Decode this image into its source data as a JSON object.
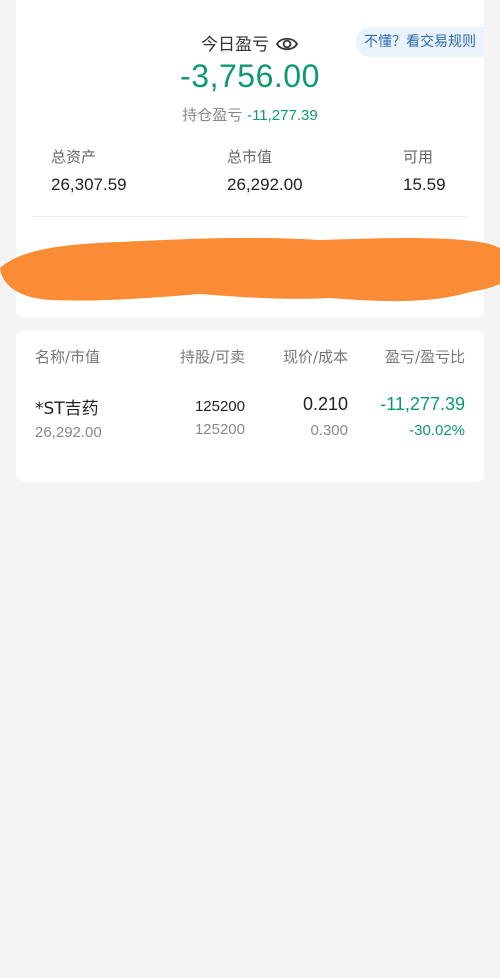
{
  "account": {
    "today_pl_label": "今日盈亏",
    "rules_button": "不懂？看交易规则",
    "today_pl_value": "-3,756.00",
    "holding_pl_label": "持仓盈亏",
    "holding_pl_value": "-11,277.39",
    "stats": [
      {
        "label": "总资产",
        "value": "26,307.59"
      },
      {
        "label": "总市值",
        "value": "26,292.00"
      },
      {
        "label": "可用",
        "value": "15.59"
      }
    ],
    "redaction_color": "#fa8c35"
  },
  "positions": {
    "headers": [
      "名称/市值",
      "持股/可卖",
      "现价/成本",
      "盈亏/盈亏比"
    ],
    "rows": [
      {
        "name": "*ST吉药",
        "market_value": "26,292.00",
        "holding": "125200",
        "available": "125200",
        "price": "0.210",
        "cost": "0.300",
        "pl": "-11,277.39",
        "pl_ratio": "-30.02%"
      }
    ]
  },
  "colors": {
    "loss_green": "#0e9a6b",
    "link_blue": "#2b6cb0",
    "background": "#f4f4f4"
  },
  "icons": {
    "visibility": "eye-icon"
  }
}
